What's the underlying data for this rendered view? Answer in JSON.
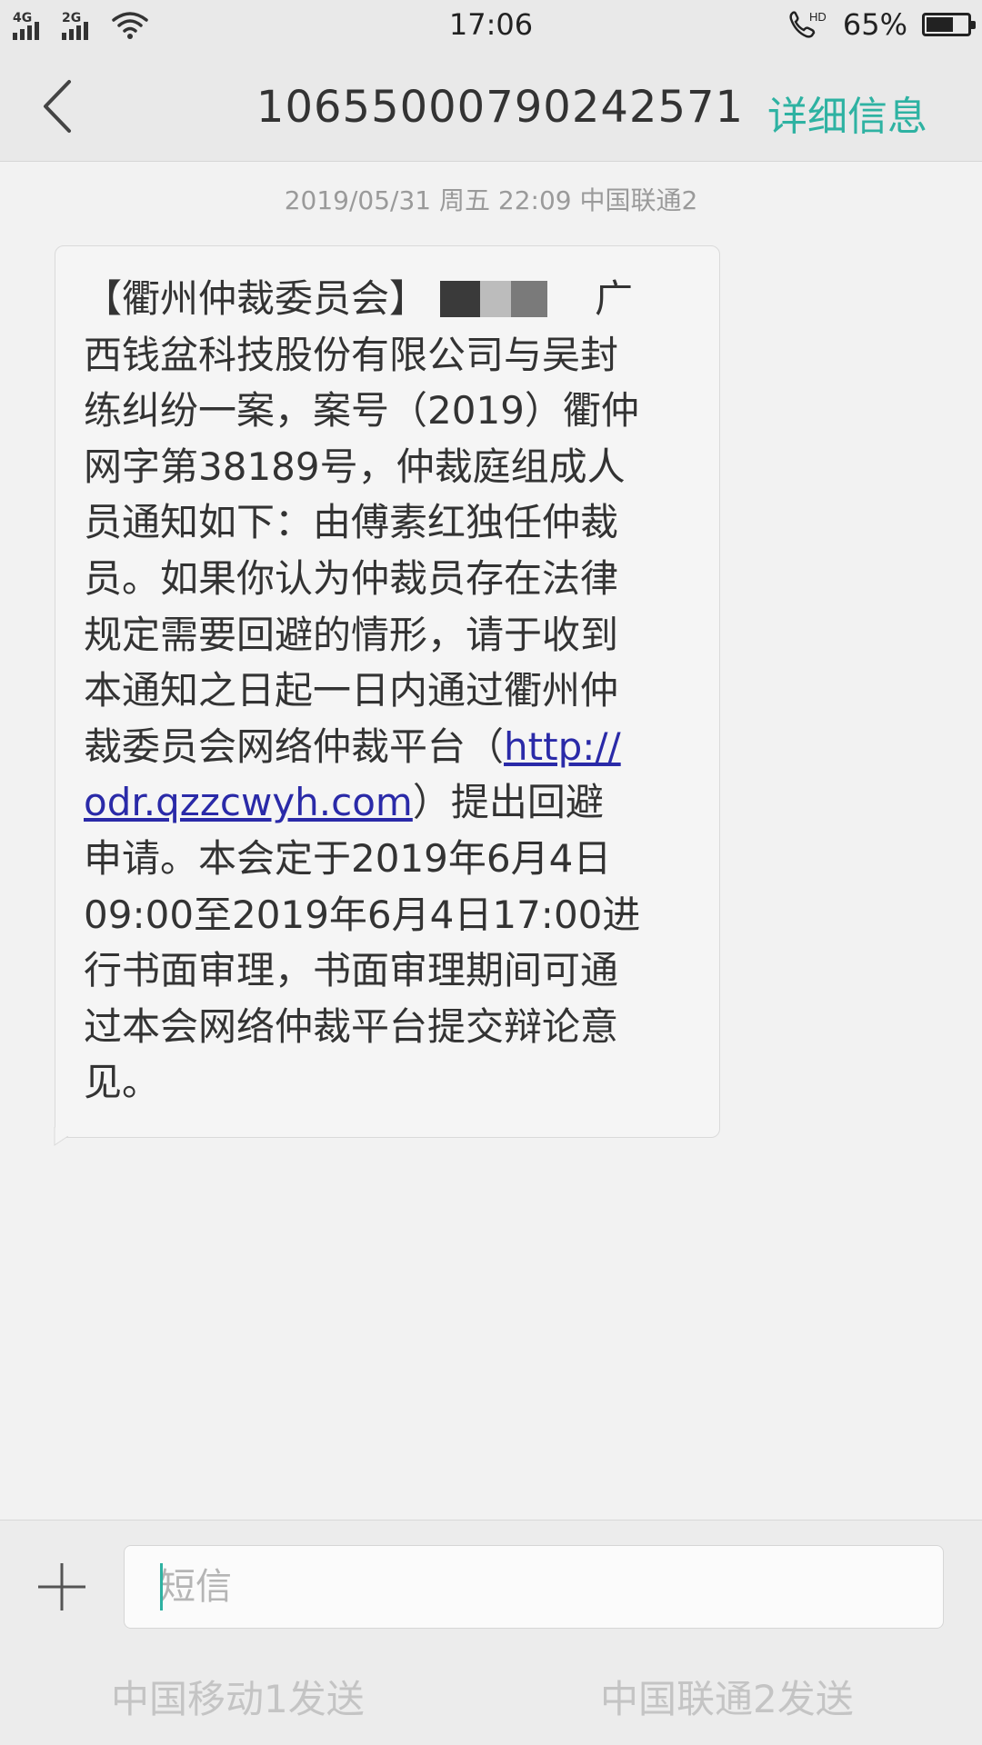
{
  "status_bar": {
    "network_1": "4G",
    "network_2": "2G",
    "time": "17:06",
    "hd_label": "HD",
    "battery_percent": "65%",
    "battery_level": 0.65
  },
  "header": {
    "title": "10655000790242571",
    "detail_link": "详细信息",
    "accent_color": "#2eb2a2"
  },
  "message": {
    "timestamp": "2019/05/31 周五  22:09  中国联通2",
    "lines": [
      {
        "before": "【衢州仲裁委员会】",
        "after": "广"
      },
      {
        "text": "西钱盆科技股份有限公司与吴封"
      },
      {
        "text": "练纠纷一案，案号（2019）衢仲"
      },
      {
        "text": "网字第38189号，仲裁庭组成人"
      },
      {
        "text": "员通知如下：由傅素红独任仲裁"
      },
      {
        "text": "员。如果你认为仲裁员存在法律"
      },
      {
        "text": "规定需要回避的情形，请于收到"
      },
      {
        "text": "本通知之日起一日内通过衢州仲"
      },
      {
        "before": "裁委员会网络仲裁平台（",
        "link": "http://"
      },
      {
        "link": "odr.qzzcwyh.com",
        "after": "）提出回避"
      },
      {
        "text": "申请。本会定于2019年6月4日"
      },
      {
        "text": "09:00至2019年6月4日17:00进"
      },
      {
        "text": "行书面审理，书面审理期间可通"
      },
      {
        "text": "过本会网络仲裁平台提交辩论意"
      },
      {
        "text": "见。"
      }
    ]
  },
  "compose": {
    "placeholder": "短信",
    "send_sim1": "中国移动1发送",
    "send_sim2": "中国联通2发送"
  }
}
